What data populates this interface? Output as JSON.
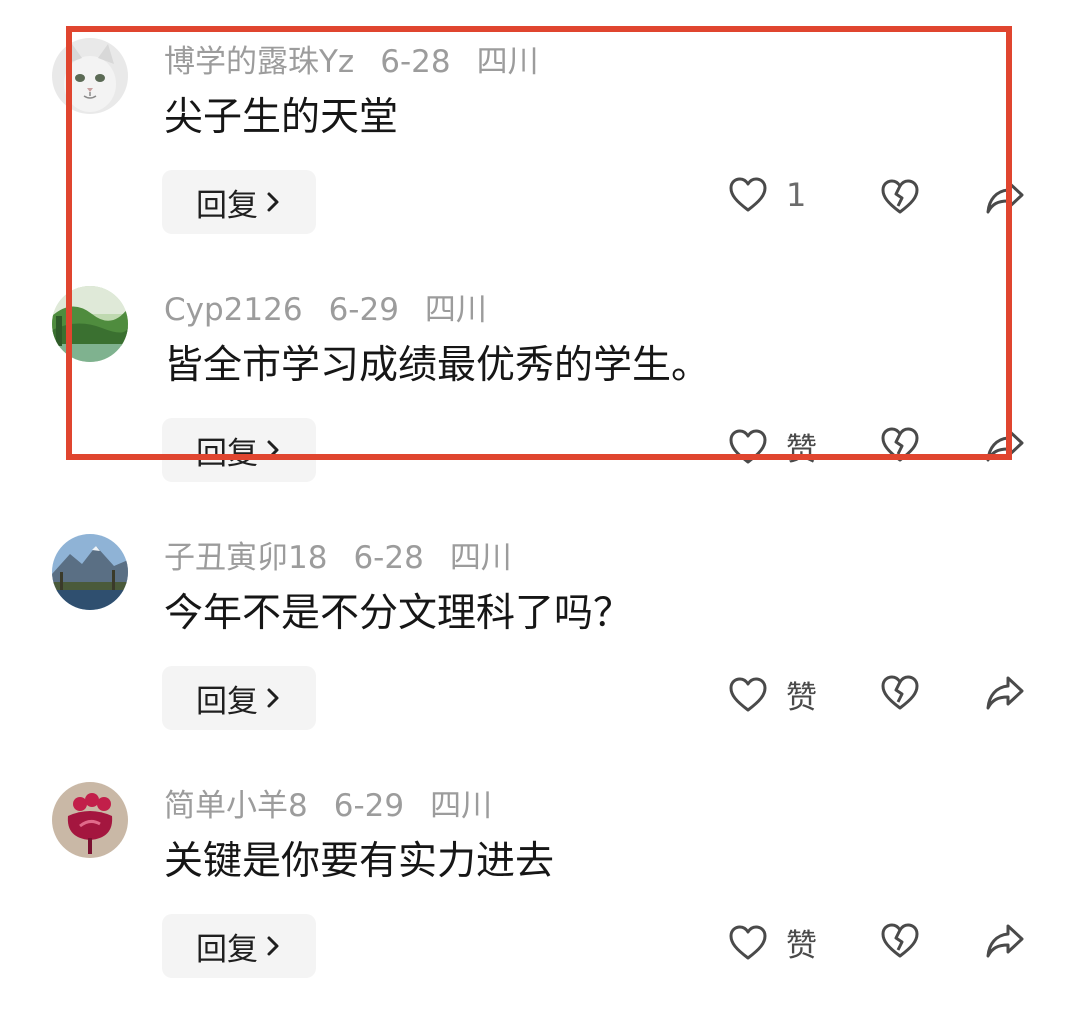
{
  "comments": [
    {
      "username": "博学的露珠Yz",
      "date": "6-28",
      "location": "四川",
      "text": "尖子生的天堂",
      "reply_label": "回复",
      "like_count": "1",
      "avatar": "cat-avatar"
    },
    {
      "username": "Cyp2126",
      "date": "6-29",
      "location": "四川",
      "text": "皆全市学习成绩最优秀的学生。",
      "reply_label": "回复",
      "like_label": "赞",
      "avatar": "landscape-avatar"
    },
    {
      "username": "子丑寅卯18",
      "date": "6-28",
      "location": "四川",
      "text": "今年不是不分文理科了吗？",
      "reply_label": "回复",
      "like_label": "赞",
      "avatar": "mountain-lake-avatar"
    },
    {
      "username": "简单小羊8",
      "date": "6-29",
      "location": "四川",
      "text": "关键是你要有实力进去",
      "reply_label": "回复",
      "like_label": "赞",
      "avatar": "flower-avatar"
    }
  ],
  "colors": {
    "highlight_border": "#e0452f",
    "meta_text": "#9c9c9c",
    "button_bg": "#f4f4f4"
  }
}
